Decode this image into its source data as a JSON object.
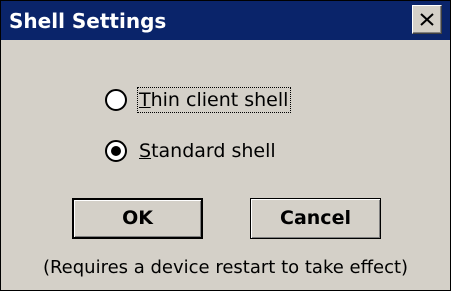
{
  "window": {
    "title": "Shell Settings",
    "close_icon": "close-x-icon",
    "title_bar_color": "#0a246a",
    "background_color": "#d4d0c8"
  },
  "options": [
    {
      "label_underlined": "T",
      "label_rest": "hin client shell",
      "selected": false,
      "focused": true
    },
    {
      "label_underlined": "S",
      "label_rest": "tandard shell",
      "selected": true,
      "focused": false
    }
  ],
  "buttons": {
    "ok_label": "OK",
    "cancel_label": "Cancel"
  },
  "note": "(Requires a device restart to take effect)"
}
